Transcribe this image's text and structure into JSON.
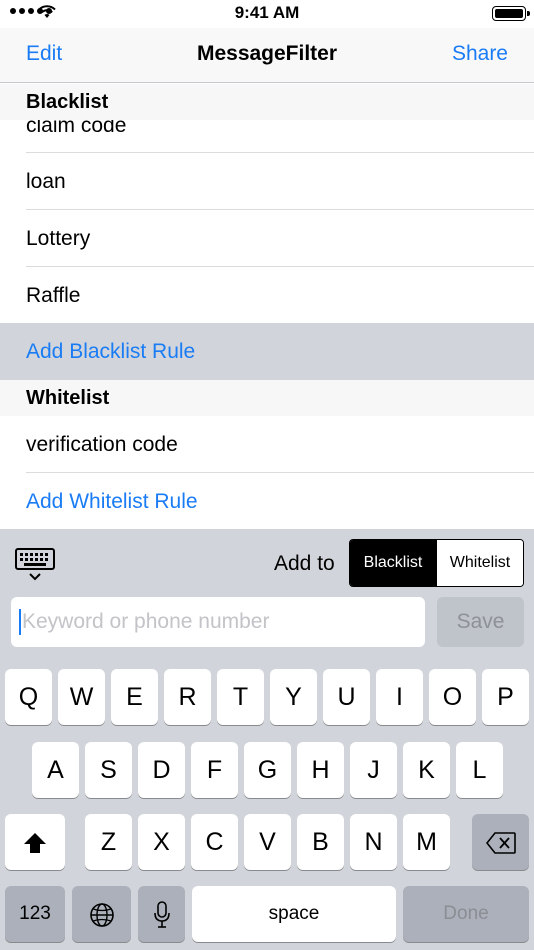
{
  "status_bar": {
    "time": "9:41 AM"
  },
  "nav": {
    "left_button": "Edit",
    "title": "MessageFilter",
    "right_button": "Share"
  },
  "blacklist": {
    "header": "Blacklist",
    "items": [
      "claim code",
      "loan",
      "Lottery",
      "Raffle"
    ],
    "add_label": "Add Blacklist Rule"
  },
  "whitelist": {
    "header": "Whitelist",
    "items": [
      "verification code"
    ],
    "add_label": "Add Whitelist Rule"
  },
  "accessory": {
    "add_to_label": "Add to",
    "segments": [
      "Blacklist",
      "Whitelist"
    ],
    "selected_segment": "Blacklist",
    "input_placeholder": "Keyword or phone number",
    "input_value": "",
    "save_label": "Save"
  },
  "keyboard": {
    "row1": [
      "Q",
      "W",
      "E",
      "R",
      "T",
      "Y",
      "U",
      "I",
      "O",
      "P"
    ],
    "row2": [
      "A",
      "S",
      "D",
      "F",
      "G",
      "H",
      "J",
      "K",
      "L"
    ],
    "row3": [
      "Z",
      "X",
      "C",
      "V",
      "B",
      "N",
      "M"
    ],
    "numbers_label": "123",
    "space_label": "space",
    "done_label": "Done"
  },
  "colors": {
    "accent": "#1a7cf5",
    "keyboard_bg": "#d1d4da",
    "highlight": "#d1d5db"
  }
}
